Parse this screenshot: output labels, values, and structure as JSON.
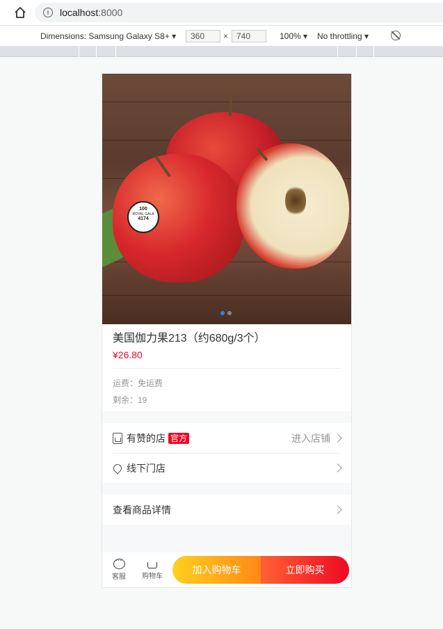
{
  "browser": {
    "url_host": "localhost",
    "url_port": ":8000",
    "device_label": "Dimensions: Samsung Galaxy S8+",
    "width": "360",
    "height": "740",
    "times": "×",
    "zoom": "100%",
    "throttle": "No throttling"
  },
  "product": {
    "title": "美国伽力果213（约680g/3个）",
    "price": "¥26.80",
    "shipping": "运费：免运费",
    "stock": "剩余：19",
    "sticker_lines": [
      "100",
      "ROYAL GALA",
      "4174"
    ]
  },
  "shop": {
    "name": "有赞的店",
    "tag": "官方",
    "enter_label": "进入店铺",
    "offline_label": "线下门店"
  },
  "details": {
    "label": "查看商品详情"
  },
  "actions": {
    "service_label": "客服",
    "cart_label": "购物车",
    "add_cart_label": "加入购物车",
    "buy_label": "立即购买"
  },
  "colors": {
    "price": "#ee0a24",
    "tag_bg": "#ee0a24",
    "add_cart_gradient": [
      "#ffd01e",
      "#ff8917"
    ],
    "buy_gradient": [
      "#ff6034",
      "#ee0a24"
    ],
    "swipe_active": "#1989fa"
  }
}
